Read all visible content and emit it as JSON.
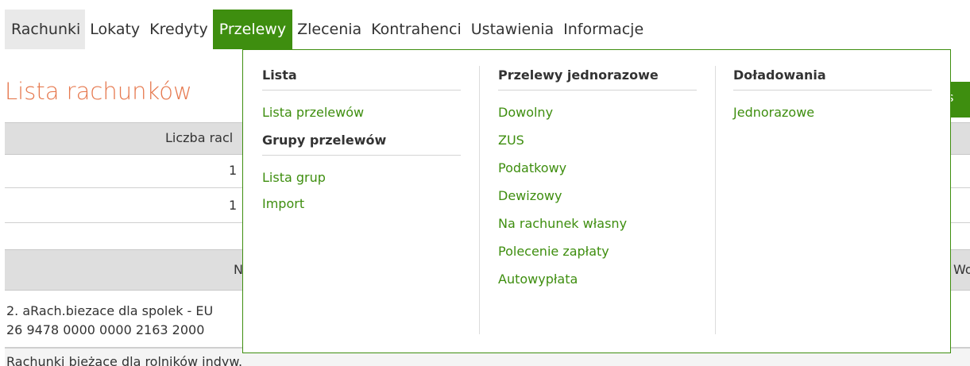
{
  "nav": {
    "items": [
      {
        "label": "Rachunki"
      },
      {
        "label": "Lokaty"
      },
      {
        "label": "Kredyty"
      },
      {
        "label": "Przelewy"
      },
      {
        "label": "Zlecenia"
      },
      {
        "label": "Kontrahenci"
      },
      {
        "label": "Ustawienia"
      },
      {
        "label": "Informacje"
      }
    ],
    "active": "Przelewy"
  },
  "page": {
    "title": "Lista rachunków",
    "button_fragment": "ps",
    "summary_header": "Liczba racl",
    "summary_rows": [
      "1",
      "1"
    ],
    "table_header_left": "N",
    "table_header_right": "Wo",
    "account_name": "2. aRach.biezace dla spolek - EU",
    "account_number": "26 9478 0000 0000 2163 2000",
    "group_label": "Rachunki bieżące dla rolników indyw."
  },
  "dropdown": {
    "col1": {
      "heading": "Lista",
      "links": [
        "Lista przelewów"
      ],
      "heading2": "Grupy przelewów",
      "links2": [
        "Lista grup",
        "Import"
      ]
    },
    "col2": {
      "heading": "Przelewy jednorazowe",
      "links": [
        "Dowolny",
        "ZUS",
        "Podatkowy",
        "Dewizowy",
        "Na rachunek własny",
        "Polecenie zapłaty",
        "Autowypłata"
      ]
    },
    "col3": {
      "heading": "Doładowania",
      "links": [
        "Jednorazowe"
      ]
    }
  },
  "colors": {
    "accent": "#3e8e0f",
    "title": "#e6794f"
  }
}
